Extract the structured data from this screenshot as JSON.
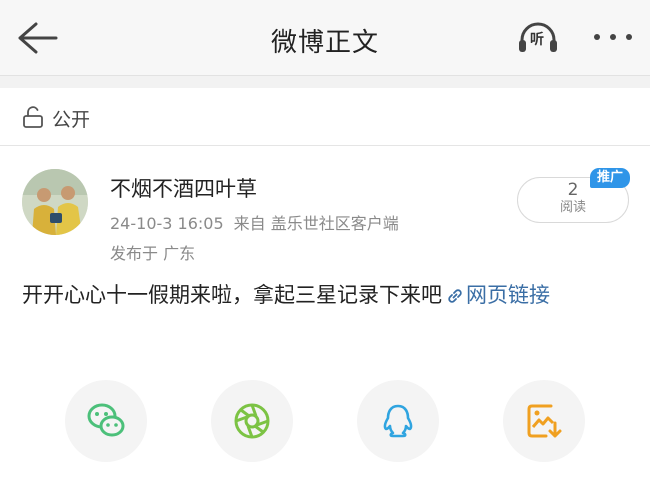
{
  "header": {
    "title": "微博正文",
    "listen_label": "听"
  },
  "visibility": {
    "label": "公开"
  },
  "post": {
    "username": "不烟不酒四叶草",
    "date": "24-10-3 16:05",
    "source": "来自 盖乐世社区客户端",
    "location": "发布于 广东",
    "read_count": "2",
    "read_label": "阅读",
    "promote_badge": "推广",
    "text": "开开心心十一假期来啦，拿起三星记录下来吧",
    "link_text": "网页链接"
  },
  "share": {
    "icons": [
      "wechat-icon",
      "moments-icon",
      "qq-icon",
      "save-image-icon"
    ]
  },
  "colors": {
    "link": "#3a6ea5",
    "badge": "#2f95e8",
    "wechat": "#4cc07a",
    "moments": "#7cc344",
    "qq": "#2fa4e0",
    "save": "#f0a020"
  }
}
